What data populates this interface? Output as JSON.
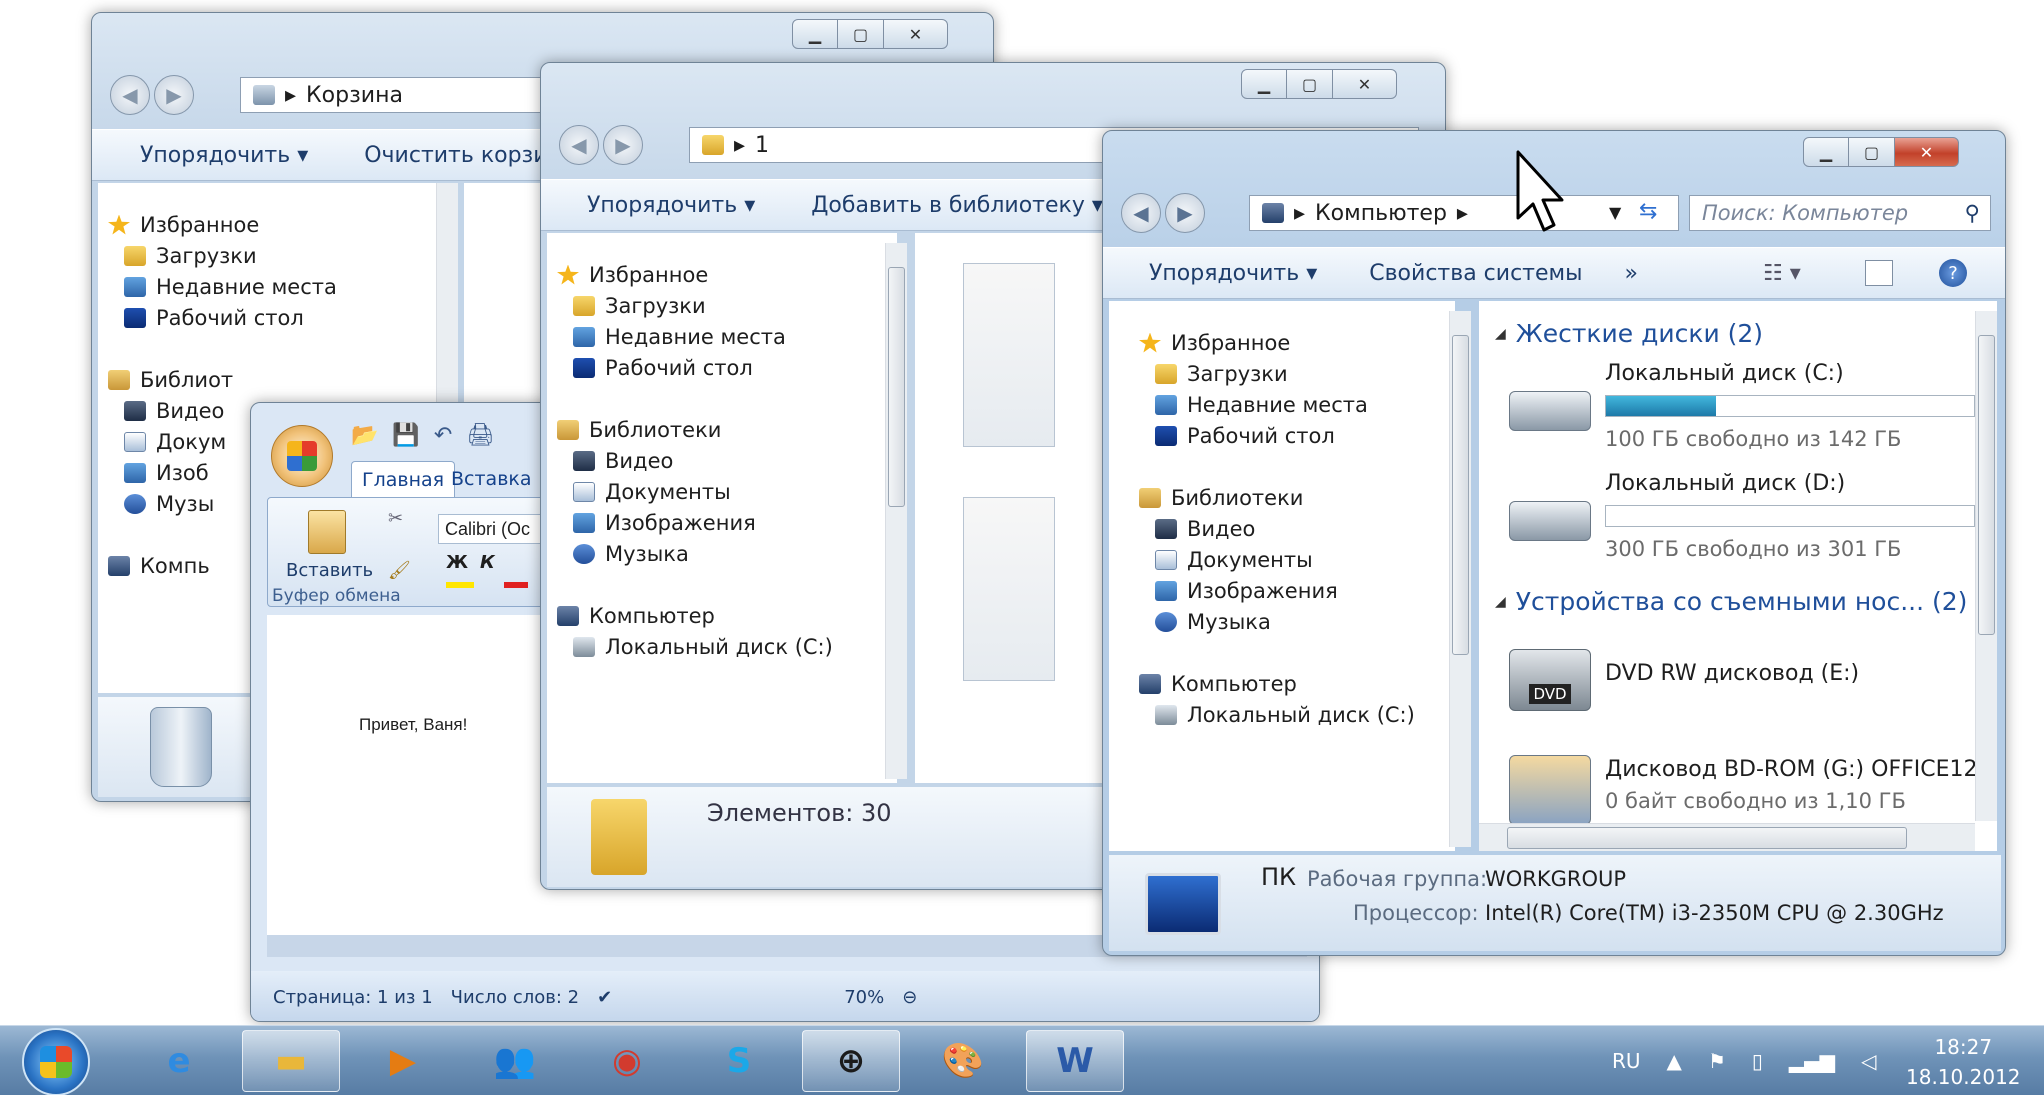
{
  "win_recycle": {
    "address": "Корзина",
    "cmd": [
      "Упорядочить ▾",
      "Очистить корзину"
    ],
    "nav": [
      {
        "label": "Избранное",
        "icon": "star-icon",
        "cls": "fav",
        "indent": 0
      },
      {
        "label": "Загрузки",
        "icon": "downloads-folder-icon",
        "cls": "fold",
        "indent": 1
      },
      {
        "label": "Недавние места",
        "icon": "recent-places-icon",
        "cls": "img",
        "indent": 1
      },
      {
        "label": "Рабочий стол",
        "icon": "desktop-icon",
        "cls": "desk",
        "indent": 1
      },
      {
        "label": "",
        "icon": "",
        "cls": "",
        "indent": 0
      },
      {
        "label": "Библиот",
        "icon": "libraries-icon",
        "cls": "lib",
        "indent": 0
      },
      {
        "label": "Видео",
        "icon": "video-icon",
        "cls": "vid",
        "indent": 1
      },
      {
        "label": "Докум",
        "icon": "documents-icon",
        "cls": "doc",
        "indent": 1
      },
      {
        "label": "Изоб",
        "icon": "pictures-icon",
        "cls": "img",
        "indent": 1
      },
      {
        "label": "Музы",
        "icon": "music-icon",
        "cls": "mus",
        "indent": 1
      },
      {
        "label": "",
        "icon": "",
        "cls": "",
        "indent": 0
      },
      {
        "label": "Компь",
        "icon": "computer-icon",
        "cls": "pc",
        "indent": 0
      }
    ]
  },
  "win_folder": {
    "address": "1",
    "cmd": [
      "Упорядочить ▾",
      "Добавить в библиотеку ▾"
    ],
    "nav": [
      {
        "label": "Избранное",
        "icon": "star-icon",
        "cls": "fav",
        "indent": 0
      },
      {
        "label": "Загрузки",
        "icon": "downloads-folder-icon",
        "cls": "fold",
        "indent": 1
      },
      {
        "label": "Недавние места",
        "icon": "recent-places-icon",
        "cls": "img",
        "indent": 1
      },
      {
        "label": "Рабочий стол",
        "icon": "desktop-icon",
        "cls": "desk",
        "indent": 1
      },
      {
        "label": "",
        "icon": "",
        "cls": "",
        "indent": 0
      },
      {
        "label": "Библиотеки",
        "icon": "libraries-icon",
        "cls": "lib",
        "indent": 0
      },
      {
        "label": "Видео",
        "icon": "video-icon",
        "cls": "vid",
        "indent": 1
      },
      {
        "label": "Документы",
        "icon": "documents-icon",
        "cls": "doc",
        "indent": 1
      },
      {
        "label": "Изображения",
        "icon": "pictures-icon",
        "cls": "img",
        "indent": 1
      },
      {
        "label": "Музыка",
        "icon": "music-icon",
        "cls": "mus",
        "indent": 1
      },
      {
        "label": "",
        "icon": "",
        "cls": "",
        "indent": 0
      },
      {
        "label": "Компьютер",
        "icon": "computer-icon",
        "cls": "pc",
        "indent": 0
      },
      {
        "label": "Локальный диск (C:)",
        "icon": "drive-icon",
        "cls": "drv",
        "indent": 1
      }
    ],
    "status": "Элементов: 30"
  },
  "win_computer": {
    "address": "Компьютер",
    "search_placeholder": "Поиск: Компьютер",
    "cmd": [
      "Упорядочить ▾",
      "Свойства системы",
      "»"
    ],
    "nav": [
      {
        "label": "Избранное",
        "icon": "star-icon",
        "cls": "fav",
        "indent": 0
      },
      {
        "label": "Загрузки",
        "icon": "downloads-folder-icon",
        "cls": "fold",
        "indent": 1
      },
      {
        "label": "Недавние места",
        "icon": "recent-places-icon",
        "cls": "img",
        "indent": 1
      },
      {
        "label": "Рабочий стол",
        "icon": "desktop-icon",
        "cls": "desk",
        "indent": 1
      },
      {
        "label": "",
        "icon": "",
        "cls": "",
        "indent": 0
      },
      {
        "label": "Библиотеки",
        "icon": "libraries-icon",
        "cls": "lib",
        "indent": 0
      },
      {
        "label": "Видео",
        "icon": "video-icon",
        "cls": "vid",
        "indent": 1
      },
      {
        "label": "Документы",
        "icon": "documents-icon",
        "cls": "doc",
        "indent": 1
      },
      {
        "label": "Изображения",
        "icon": "pictures-icon",
        "cls": "img",
        "indent": 1
      },
      {
        "label": "Музыка",
        "icon": "music-icon",
        "cls": "mus",
        "indent": 1
      },
      {
        "label": "",
        "icon": "",
        "cls": "",
        "indent": 0
      },
      {
        "label": "Компьютер",
        "icon": "computer-icon",
        "cls": "pc",
        "indent": 0
      },
      {
        "label": "Локальный диск (C:)",
        "icon": "drive-icon",
        "cls": "drv",
        "indent": 1
      }
    ],
    "group_hdd": "Жесткие диски (2)",
    "group_removable": "Устройства со съемными нос... (2)",
    "drives": [
      {
        "name": "Локальный диск (C:)",
        "free": "100 ГБ свободно из 142 ГБ",
        "used_fraction": 0.3
      },
      {
        "name": "Локальный диск (D:)",
        "free": "300 ГБ свободно из 301 ГБ",
        "used_fraction": 0.0
      }
    ],
    "dvd_name": "DVD RW дисковод (E:)",
    "dvd_badge": "DVD",
    "bd_name": "Дисковод BD-ROM (G:) OFFICE12",
    "bd_free": "0 байт свободно из 1,10 ГБ",
    "details": {
      "name": "ПК",
      "workgroup_label": "Рабочая группа:",
      "workgroup": "WORKGROUP",
      "cpu_label": "Процессор:",
      "cpu": "Intel(R) Core(TM) i3-2350M CPU @ 2.30GHz"
    }
  },
  "word": {
    "tabs": [
      "Главная",
      "Вставка"
    ],
    "paste_label": "Вставить",
    "clipboard_group": "Буфер обмена",
    "font": "Calibri (Oc",
    "bold": "Ж",
    "italic": "К",
    "doc_text": "Привет, Ваня!",
    "status_page": "Страница: 1 из 1",
    "status_words": "Число слов: 2",
    "zoom": "70%"
  },
  "taskbar": {
    "lang": "RU",
    "time": "18:27",
    "date": "18.10.2012",
    "apps": [
      {
        "name": "internet-explorer-icon",
        "glyph": "e",
        "color": "#2f8be0",
        "active": false
      },
      {
        "name": "explorer-folder-icon",
        "glyph": "▬",
        "color": "#e9b73a",
        "active": true
      },
      {
        "name": "media-player-icon",
        "glyph": "▶",
        "color": "#e57c12",
        "active": false
      },
      {
        "name": "people-icon",
        "glyph": "👥",
        "color": "#4a8a3a",
        "active": false
      },
      {
        "name": "chrome-icon",
        "glyph": "◉",
        "color": "#d23b2e",
        "active": false
      },
      {
        "name": "skype-icon",
        "glyph": "S",
        "color": "#1ba8e8",
        "active": false
      },
      {
        "name": "globe-app-icon",
        "glyph": "⊕",
        "color": "#1b1b1b",
        "active": true
      },
      {
        "name": "paint-icon",
        "glyph": "🎨",
        "color": "#b04a2a",
        "active": false
      },
      {
        "name": "word-icon",
        "glyph": "W",
        "color": "#2b5aa8",
        "active": true
      }
    ]
  }
}
